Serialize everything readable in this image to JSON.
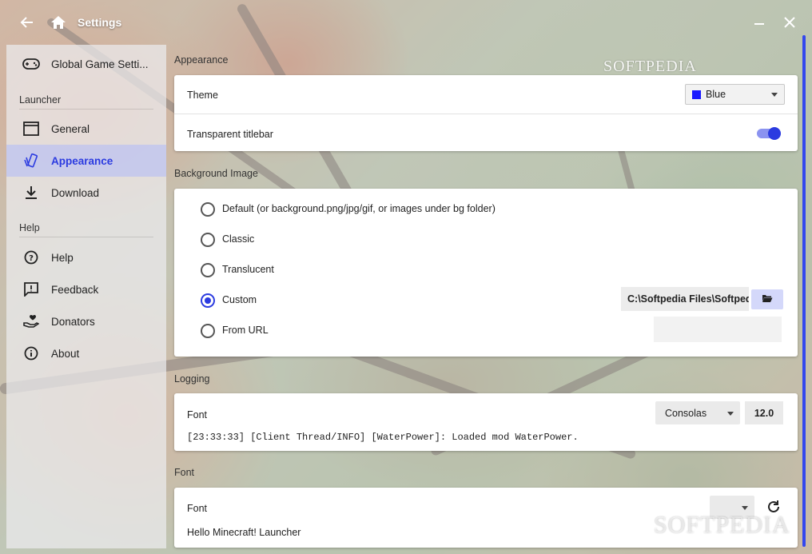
{
  "window": {
    "title": "Settings"
  },
  "icons": {
    "back": "back-arrow-icon",
    "home": "home-icon",
    "minimize": "minimize-icon",
    "close": "close-icon"
  },
  "sidebar": {
    "top_item": {
      "label": "Global Game Setti...",
      "icon": "gamepad-icon"
    },
    "sections": [
      {
        "title": "Launcher",
        "items": [
          {
            "label": "General",
            "icon": "window-icon",
            "active": false
          },
          {
            "label": "Appearance",
            "icon": "palette-icon",
            "active": true
          },
          {
            "label": "Download",
            "icon": "download-icon",
            "active": false
          }
        ]
      },
      {
        "title": "Help",
        "items": [
          {
            "label": "Help",
            "icon": "help-circle-icon",
            "active": false
          },
          {
            "label": "Feedback",
            "icon": "feedback-icon",
            "active": false
          },
          {
            "label": "Donators",
            "icon": "donate-icon",
            "active": false
          },
          {
            "label": "About",
            "icon": "info-icon",
            "active": false
          }
        ]
      }
    ]
  },
  "appearance": {
    "section_title": "Appearance",
    "theme_label": "Theme",
    "theme_value": "Blue",
    "theme_color": "#1a1aff",
    "transparent_titlebar_label": "Transparent titlebar",
    "transparent_titlebar_on": true
  },
  "background_image": {
    "section_title": "Background Image",
    "options": [
      {
        "label": "Default (or background.png/jpg/gif, or images under bg folder)",
        "selected": false
      },
      {
        "label": "Classic",
        "selected": false
      },
      {
        "label": "Translucent",
        "selected": false
      },
      {
        "label": "Custom",
        "selected": true
      },
      {
        "label": "From URL",
        "selected": false
      }
    ],
    "custom_path": "C:\\Softpedia Files\\Softpedia",
    "url_value": ""
  },
  "logging": {
    "section_title": "Logging",
    "font_label": "Font",
    "font_family": "Consolas",
    "font_size": "12.0",
    "preview": "[23:33:33] [Client Thread/INFO] [WaterPower]: Loaded mod WaterPower."
  },
  "font": {
    "section_title": "Font",
    "font_label": "Font",
    "font_family": "",
    "preview": "Hello Minecraft! Launcher"
  },
  "colors": {
    "accent": "#2b3be0",
    "accent_light": "#d4d8fa"
  },
  "watermark": "SOFTPEDIA"
}
